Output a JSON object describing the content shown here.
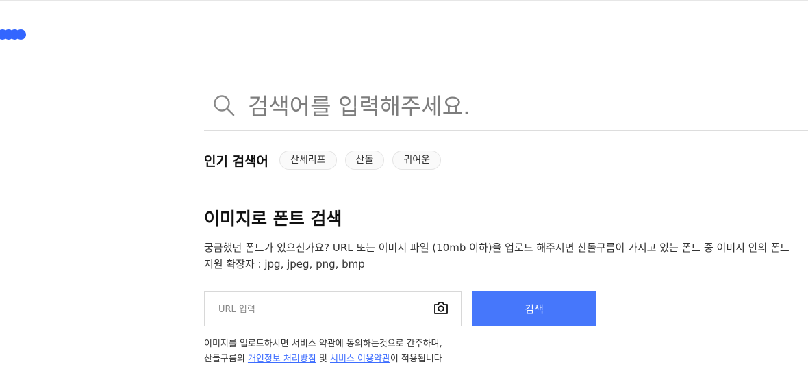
{
  "search": {
    "placeholder": "검색어를 입력해주세요."
  },
  "popular": {
    "label": "인기 검색어",
    "chips": [
      "산세리프",
      "산돌",
      "귀여운"
    ]
  },
  "image_search": {
    "title": "이미지로 폰트 검색",
    "description_line1": "궁금했던 폰트가 있으신가요? URL 또는 이미지 파일 (10mb 이하)을 업로드 해주시면 산돌구름이 가지고 있는 폰트 중 이미지 안의 폰트",
    "description_line2": "지원 확장자 : jpg, jpeg, png, bmp",
    "url_placeholder": "URL 입력",
    "search_button": "검색"
  },
  "terms": {
    "line1": "이미지를 업로드하시면 서비스 약관에 동의하는것으로 간주하며,",
    "line2_prefix": "산돌구름의 ",
    "privacy_link": "개인정보 처리방침",
    "conjunction": " 및 ",
    "service_link": "서비스 이용약관",
    "line2_suffix": "이 적용됩니다"
  },
  "colors": {
    "accent": "#4677fb",
    "loader": "#3366ff",
    "link": "#3d6dff"
  }
}
